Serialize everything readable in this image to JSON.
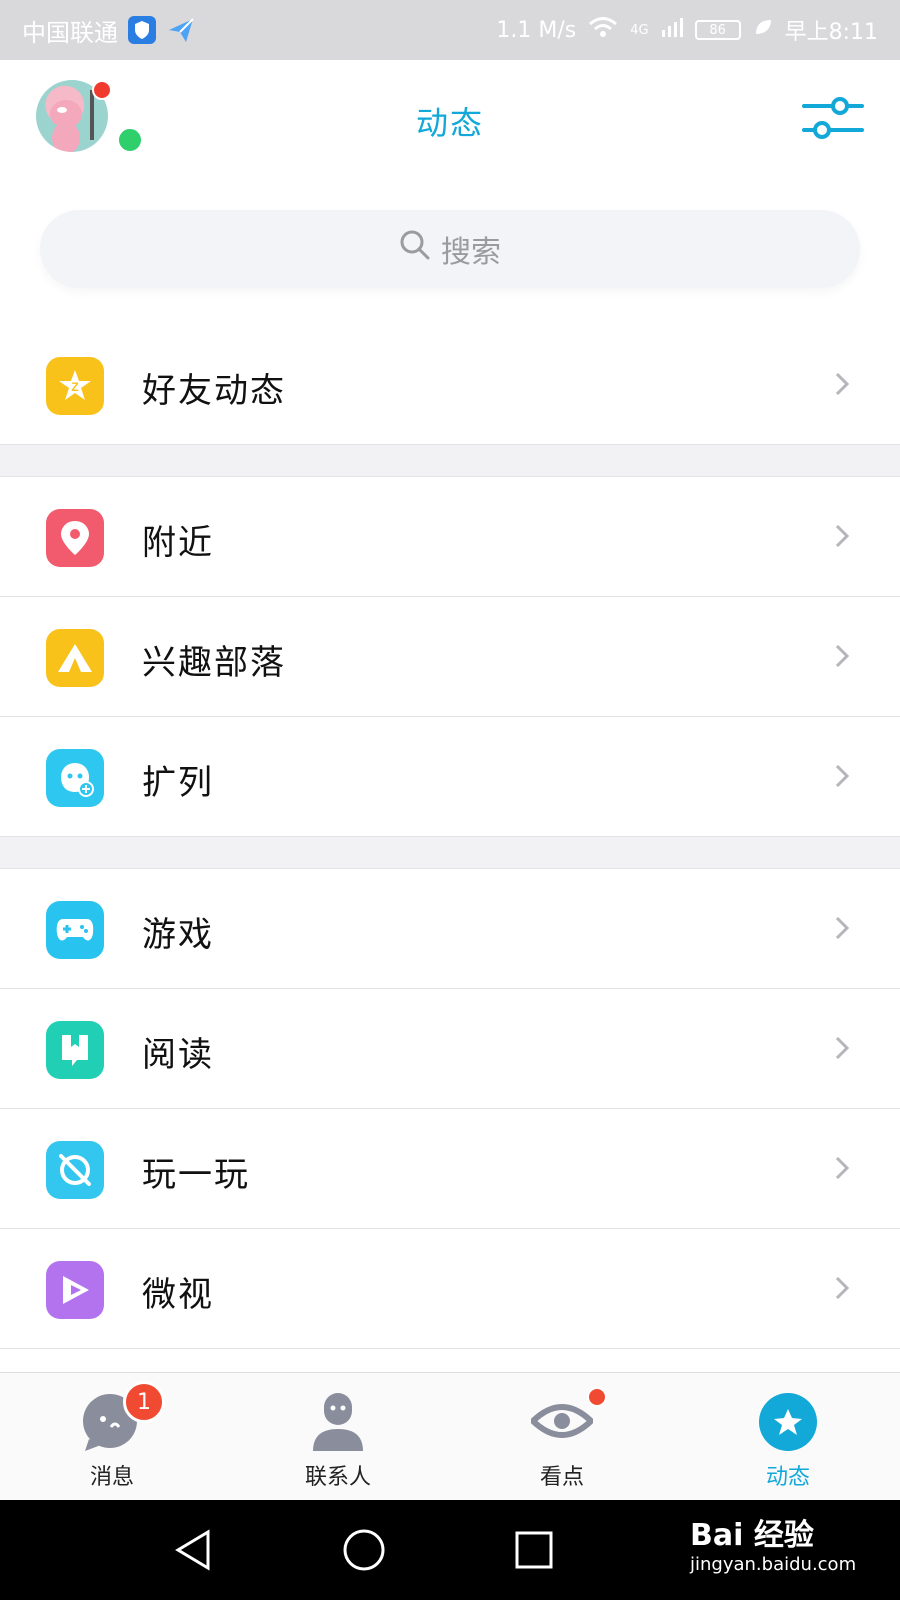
{
  "status_bar": {
    "carrier": "中国联通",
    "speed": "1.1 M/s",
    "network": "4G",
    "battery": "86",
    "time": "早上8:11"
  },
  "header": {
    "title": "动态"
  },
  "search": {
    "placeholder": "搜索"
  },
  "list": {
    "group1": [
      {
        "label": "好友动态",
        "icon": "qzone-star-icon",
        "color": "#f8c21a"
      }
    ],
    "group2": [
      {
        "label": "附近",
        "icon": "location-pin-icon",
        "color": "#f25b6e"
      },
      {
        "label": "兴趣部落",
        "icon": "tent-icon",
        "color": "#f8c21a"
      },
      {
        "label": "扩列",
        "icon": "add-friend-face-icon",
        "color": "#2ec7f0"
      }
    ],
    "group3": [
      {
        "label": "游戏",
        "icon": "gamepad-icon",
        "color": "#29c3ef"
      },
      {
        "label": "阅读",
        "icon": "book-icon",
        "color": "#20cfb4"
      },
      {
        "label": "玩一玩",
        "icon": "planet-icon",
        "color": "#33c6ef"
      },
      {
        "label": "微视",
        "icon": "play-icon",
        "color": "#b373ef"
      }
    ]
  },
  "tabs": [
    {
      "label": "消息",
      "icon": "message-icon",
      "badge": "1"
    },
    {
      "label": "联系人",
      "icon": "contacts-icon"
    },
    {
      "label": "看点",
      "icon": "eye-icon"
    },
    {
      "label": "动态",
      "icon": "star-circle-icon",
      "active": true
    }
  ],
  "colors": {
    "accent": "#12a8d8",
    "badge": "#f04b32"
  },
  "watermark": {
    "main": "Bai 经验",
    "sub": "jingyan.baidu.com"
  }
}
